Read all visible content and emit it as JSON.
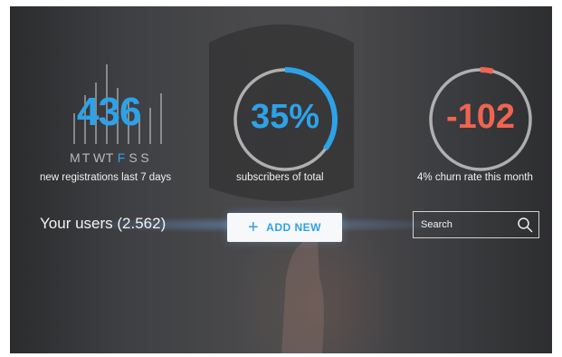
{
  "stats": {
    "registrations": {
      "value": "436",
      "days": [
        "M",
        "T",
        "W",
        "T",
        "F",
        "S",
        "S"
      ],
      "active_day_index": 4,
      "caption": "new registrations last 7 days",
      "accent": "#2ea2e8"
    },
    "subscribers": {
      "value": "35%",
      "caption": "subscribers of total",
      "progress_fraction": 0.35,
      "accent": "#2ea2e8"
    },
    "churn": {
      "value": "-102",
      "caption": "4% churn rate this month",
      "progress_fraction": 0.04,
      "accent": "#f06450"
    }
  },
  "users": {
    "label": "Your users",
    "count": "(2.562)"
  },
  "add_button": {
    "label": "ADD NEW",
    "icon": "plus-icon"
  },
  "search": {
    "placeholder": "Search",
    "icon": "search-icon"
  }
}
